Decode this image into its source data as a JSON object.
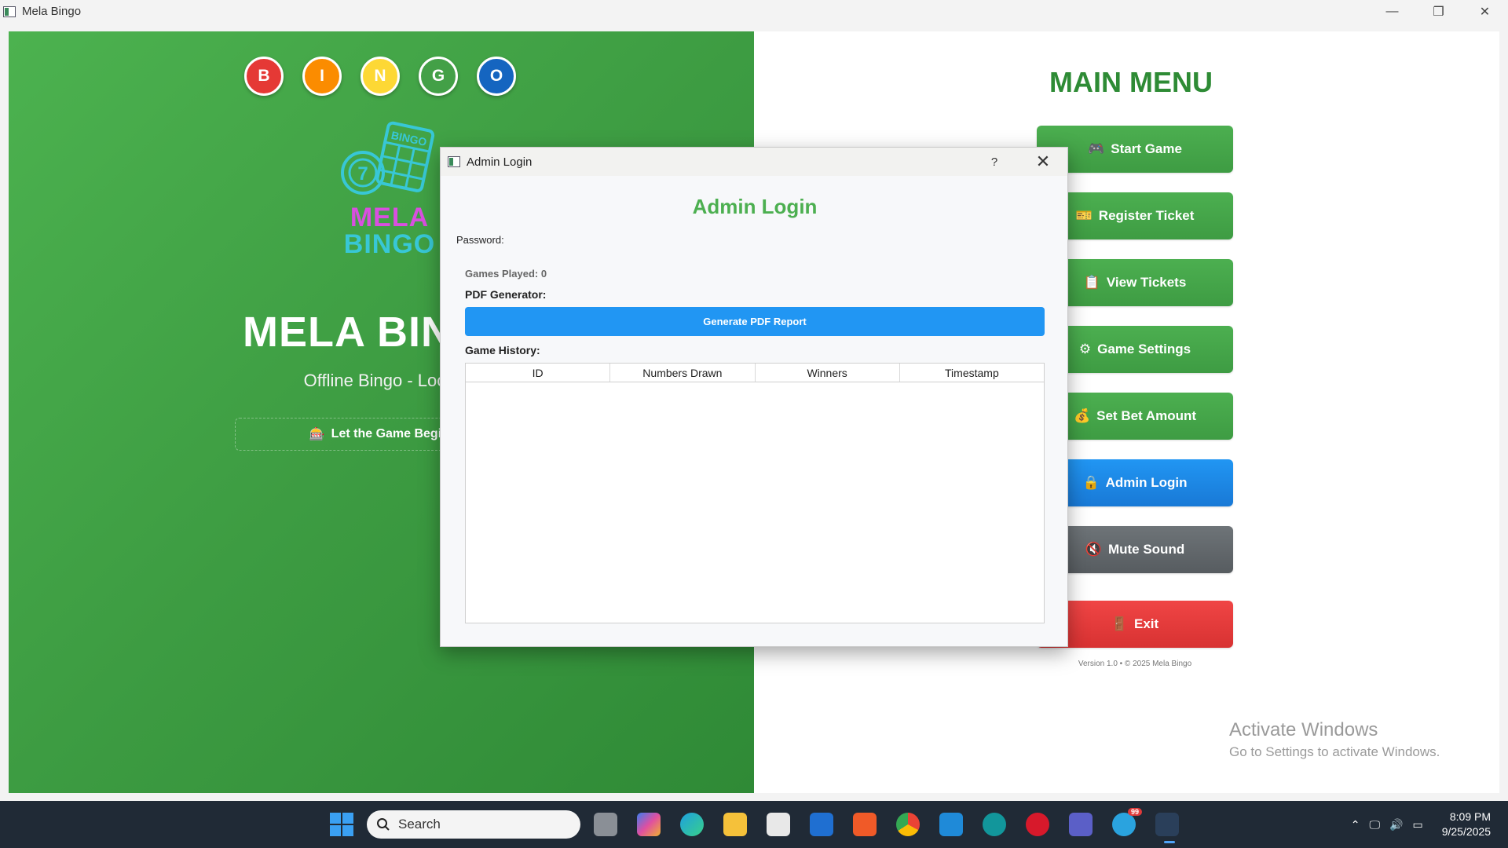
{
  "window": {
    "title": "Mela Bingo",
    "minimize_glyph": "—",
    "restore_glyph": "❐",
    "close_glyph": "✕"
  },
  "left_panel": {
    "balls": [
      {
        "letter": "B",
        "color": "#e53935"
      },
      {
        "letter": "I",
        "color": "#fb8c00"
      },
      {
        "letter": "N",
        "color": "#fdd835"
      },
      {
        "letter": "G",
        "color": "#43a047"
      },
      {
        "letter": "O",
        "color": "#1565c0"
      }
    ],
    "logo": {
      "line1": "MELA",
      "line2": "BINGO",
      "card_text": "BINGO",
      "ball_number": "7"
    },
    "title": "MELA BINGO",
    "subtitle": "Offline Bingo - Local",
    "start_button_icon": "🎰",
    "start_button_label": "Let the Game Begin!"
  },
  "right_panel": {
    "title": "MAIN MENU",
    "buttons": [
      {
        "icon": "🎮",
        "label": "Start Game",
        "style": "green"
      },
      {
        "icon": "🎫",
        "label": "Register Ticket",
        "style": "green"
      },
      {
        "icon": "📋",
        "label": "View Tickets",
        "style": "green"
      },
      {
        "icon": "⚙",
        "label": "Game Settings",
        "style": "green"
      },
      {
        "icon": "💰",
        "label": "Set Bet Amount",
        "style": "green"
      },
      {
        "icon": "🔒",
        "label": "Admin Login",
        "style": "blue"
      },
      {
        "icon": "🔇",
        "label": "Mute Sound",
        "style": "gray"
      },
      {
        "icon": "🚪",
        "label": "Exit",
        "style": "red"
      }
    ],
    "version": "Version 1.0 • © 2025 Mela Bingo"
  },
  "watermark": {
    "title": "Activate Windows",
    "subtitle": "Go to Settings to activate Windows."
  },
  "dialog": {
    "title": "Admin Login",
    "help": "?",
    "close": "✕",
    "heading": "Admin Login",
    "password_label": "Password:",
    "games_played": "Games Played: 0",
    "pdf_label": "PDF Generator:",
    "pdf_button": "Generate PDF Report",
    "history_label": "Game History:",
    "columns": [
      "ID",
      "Numbers Drawn",
      "Winners",
      "Timestamp"
    ],
    "rows": []
  },
  "taskbar": {
    "search_text": "Search",
    "telegram_badge": "99",
    "time": "8:09 PM",
    "date": "9/25/2025"
  },
  "colors": {
    "accent_green": "#2e8b35",
    "dialog_heading": "#4caf50",
    "pdf_button": "#2196f3"
  }
}
